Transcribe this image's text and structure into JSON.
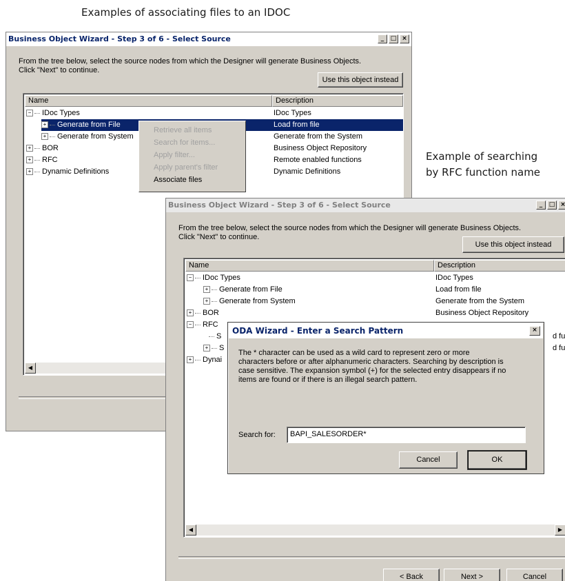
{
  "captions": {
    "top": "Examples of associating files to an IDOC",
    "right_line1": "Example of searching",
    "right_line2": "by RFC function name"
  },
  "wizard1": {
    "title": "Business Object Wizard - Step 3 of 6 - Select Source",
    "intro_line1": "From the tree below, select the source nodes from which the Designer will generate Business Objects.",
    "intro_line2": "Click \"Next\" to continue.",
    "use_object_button": "Use this object instead",
    "columns": {
      "name": "Name",
      "description": "Description"
    },
    "rows": [
      {
        "name": "IDoc Types",
        "description": "IDoc Types"
      },
      {
        "name": "Generate from File",
        "description": "Load from file"
      },
      {
        "name": "Generate from System",
        "description": "Generate from the System"
      },
      {
        "name": "BOR",
        "description": "Business Object Repository"
      },
      {
        "name": "RFC",
        "description": "Remote enabled functions"
      },
      {
        "name": "Dynamic Definitions",
        "description": "Dynamic Definitions"
      }
    ],
    "context_menu": [
      "Retrieve all items",
      "Search for items...",
      "Apply filter...",
      "Apply parent's filter",
      "Associate files"
    ]
  },
  "wizard2": {
    "title": "Business Object Wizard - Step 3 of 6 - Select Source",
    "intro_line1": "From the tree below, select the source nodes from which the Designer will generate Business Objects.",
    "intro_line2": "Click \"Next\" to continue.",
    "use_object_button": "Use this object instead",
    "columns": {
      "name": "Name",
      "description": "Description"
    },
    "rows": [
      {
        "name": "IDoc Types",
        "description": "IDoc Types"
      },
      {
        "name": "Generate from File",
        "description": "Load from file"
      },
      {
        "name": "Generate from System",
        "description": "Generate from the System"
      },
      {
        "name": "BOR",
        "description": "Business Object Repository"
      },
      {
        "name": "RFC",
        "description": ""
      },
      {
        "name": "S",
        "description": "d fun"
      },
      {
        "name": "S",
        "description": "d fun"
      },
      {
        "name": "Dynai",
        "description": ""
      }
    ],
    "back_button": "< Back",
    "next_button": "Next >",
    "cancel_button": "Cancel"
  },
  "search_dialog": {
    "title": "ODA Wizard - Enter a Search Pattern",
    "description_lines": [
      "The * character can be used as a wild card to represent zero or more",
      "characters before or after alphanumeric characters. Searching by description is",
      "case sensitive. The expansion symbol (+) for the selected entry disappears if no",
      "items are found or if there is an illegal search pattern."
    ],
    "search_label": "Search for:",
    "search_value": "BAPI_SALESORDER*",
    "cancel_button": "Cancel",
    "ok_button": "OK"
  }
}
